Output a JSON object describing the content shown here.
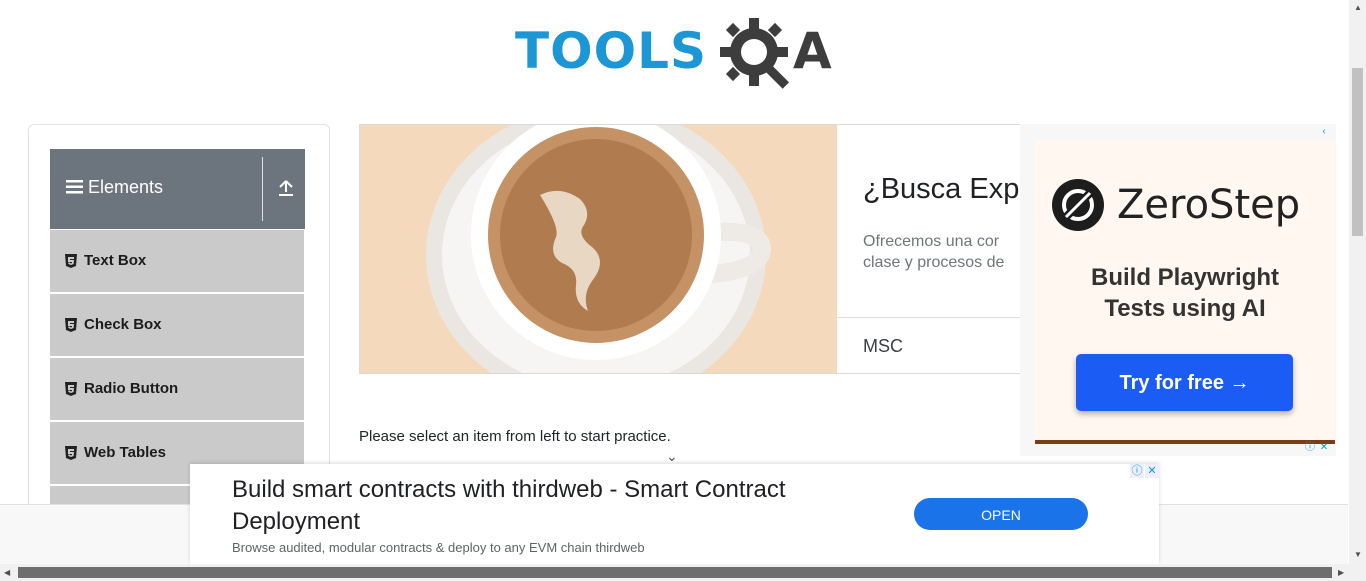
{
  "logo": {
    "part1": "TOOLS",
    "part2": "A",
    "gear_icon": "gear-magnifier-icon"
  },
  "sidebar": {
    "group_title": "Elements",
    "group_icon": "hamburger-icon",
    "collapse_icon": "upload-arrow-icon",
    "items": [
      {
        "label": "Text Box",
        "icon": "html5-shield-icon"
      },
      {
        "label": "Check Box",
        "icon": "html5-shield-icon"
      },
      {
        "label": "Radio Button",
        "icon": "html5-shield-icon"
      },
      {
        "label": "Web Tables",
        "icon": "html5-shield-icon"
      }
    ]
  },
  "banner_ad": {
    "headline": "¿Busca Expo",
    "body_line1": "Ofrecemos una cor",
    "body_line2": "clase y procesos de",
    "advertiser": "MSC"
  },
  "side_ad": {
    "brand": "ZeroStep",
    "tagline_line1": "Build Playwright",
    "tagline_line2": "Tests using AI",
    "cta": "Try for free →",
    "close_icon": "close-icon",
    "info_icon": "adchoices-icon"
  },
  "main": {
    "instructions": "Please select an item from left to start practice.",
    "scroll_hint": "⌄"
  },
  "bottom_ad": {
    "headline": "Build smart contracts with thirdweb - Smart Contract Deployment",
    "description": "Browse audited, modular contracts & deploy to any EVM chain thirdweb",
    "cta": "OPEN",
    "info_icon": "ⓘ",
    "close_icon": "✕"
  },
  "colors": {
    "brand_blue": "#1a97d4",
    "sidebar_header": "#6c757d",
    "sidebar_item": "#cacaca",
    "cta_blue": "#1a5cf4",
    "open_blue": "#1a73e8"
  }
}
